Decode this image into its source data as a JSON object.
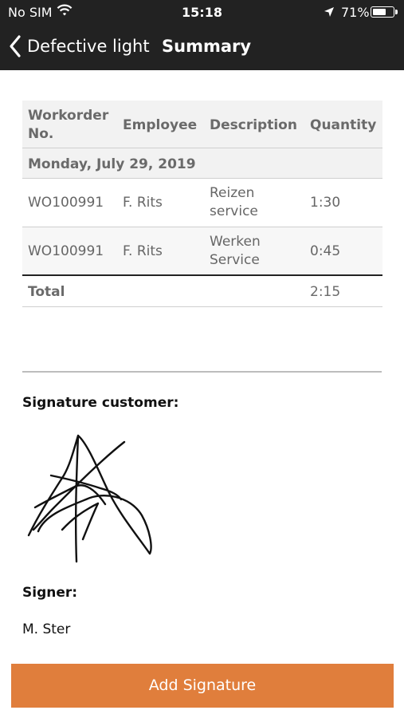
{
  "status_bar": {
    "carrier": "No SIM",
    "time": "15:18",
    "battery_percent": "71%",
    "battery_level": 0.71,
    "icons": [
      "wifi-icon",
      "location-arrow-icon",
      "battery-icon"
    ]
  },
  "nav": {
    "back_label": "Defective light",
    "title": "Summary",
    "back_icon": "chevron-left-icon"
  },
  "table": {
    "headers": {
      "workorder_line1": "Workorder",
      "workorder_line2": "No.",
      "employee": "Employee",
      "description": "Description",
      "quantity": "Quantity"
    },
    "group_date": "Monday, July 29, 2019",
    "rows": [
      {
        "workorder": "WO100991",
        "employee": "F. Rits",
        "description_line1": "Reizen",
        "description_line2": "service",
        "quantity": "1:30"
      },
      {
        "workorder": "WO100991",
        "employee": "F. Rits",
        "description_line1": "Werken",
        "description_line2": "Service",
        "quantity": "0:45"
      }
    ],
    "total_label": "Total",
    "total_value": "2:15"
  },
  "signature": {
    "label": "Signature customer:",
    "signer_label": "Signer:",
    "signer_name": "M. Ster"
  },
  "actions": {
    "add_signature": "Add Signature"
  },
  "colors": {
    "header_bg": "#222222",
    "accent": "#e07e3c",
    "table_header_bg": "#f2f2f2"
  }
}
